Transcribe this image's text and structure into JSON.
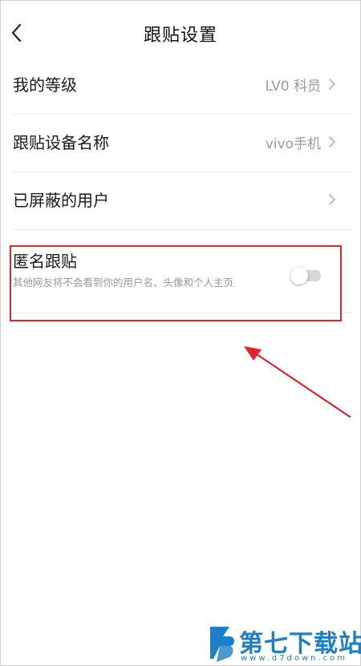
{
  "header": {
    "title": "跟贴设置",
    "back_icon": "chevron-left-icon"
  },
  "settings": {
    "rows": [
      {
        "label": "我的等级",
        "value": "LV0 科员"
      },
      {
        "label": "跟贴设备名称",
        "value": "vivo手机"
      },
      {
        "label": "已屏蔽的用户",
        "value": ""
      }
    ],
    "anonymous": {
      "label": "匿名跟贴",
      "description": "其他网友将不会看到你的用户名、头像和个人主页",
      "enabled": false
    }
  },
  "annotation": {
    "highlight_color": "#e3222b"
  },
  "watermark": {
    "text": "第七下载站",
    "url": "www.d7down.com",
    "color": "#1d7fc7"
  }
}
